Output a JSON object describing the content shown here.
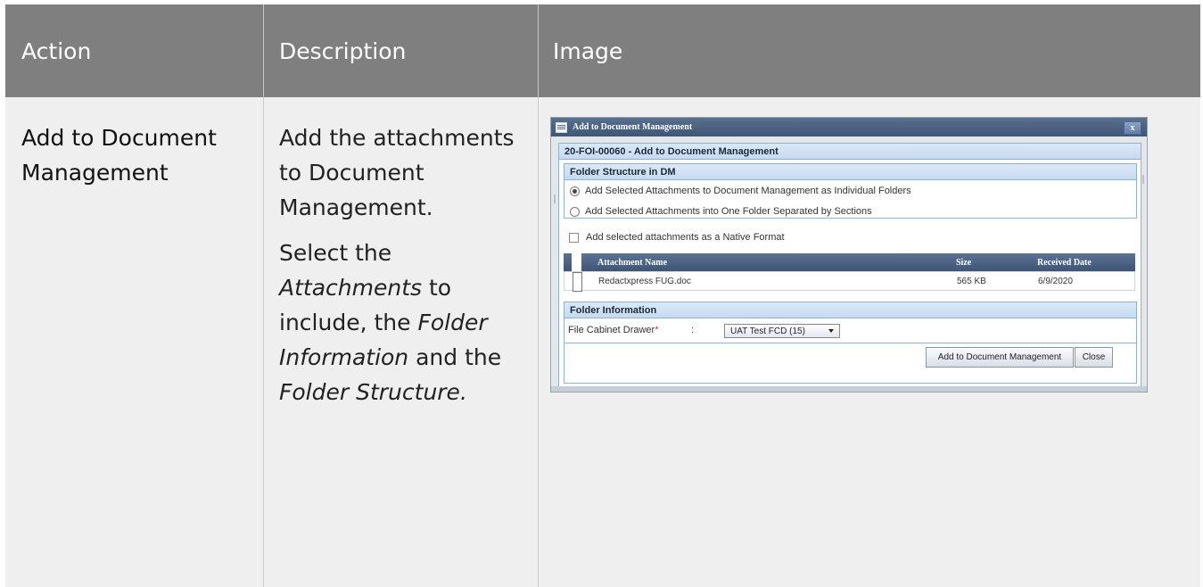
{
  "table": {
    "headers": {
      "action": "Action",
      "description": "Description",
      "image": "Image"
    },
    "row": {
      "action": "Add to Document Management",
      "description": {
        "p1": "Add the attachments to Document Management.",
        "p2_a": "Select the ",
        "p2_b": "Attachments",
        "p2_c": " to include, the ",
        "p2_d": "Folder Information",
        "p2_e": " and the ",
        "p2_f": "Folder Structure."
      }
    }
  },
  "dialog": {
    "title": "Add to Document Management",
    "close": "x",
    "header": "20-FOI-00060 - Add to Document Management",
    "folder_structure": {
      "title": "Folder Structure in DM",
      "options": [
        "Add Selected Attachments to Document Management as Individual Folders",
        "Add Selected Attachments into One Folder Separated by Sections"
      ],
      "selected_index": 0
    },
    "native_format_label": "Add selected attachments as a Native Format",
    "grid": {
      "columns": [
        "Attachment Name",
        "Size",
        "Received Date"
      ],
      "rows": [
        {
          "name": "Redactxpress FUG.doc",
          "size": "565 KB",
          "date": "6/9/2020"
        }
      ]
    },
    "folder_info": {
      "title": "Folder Information",
      "drawer_label": "File Cabinet Drawer",
      "required": "*",
      "colon": ":",
      "drawer_value": "UAT Test FCD (15)"
    },
    "buttons": {
      "add": "Add to Document Management",
      "close": "Close"
    }
  }
}
